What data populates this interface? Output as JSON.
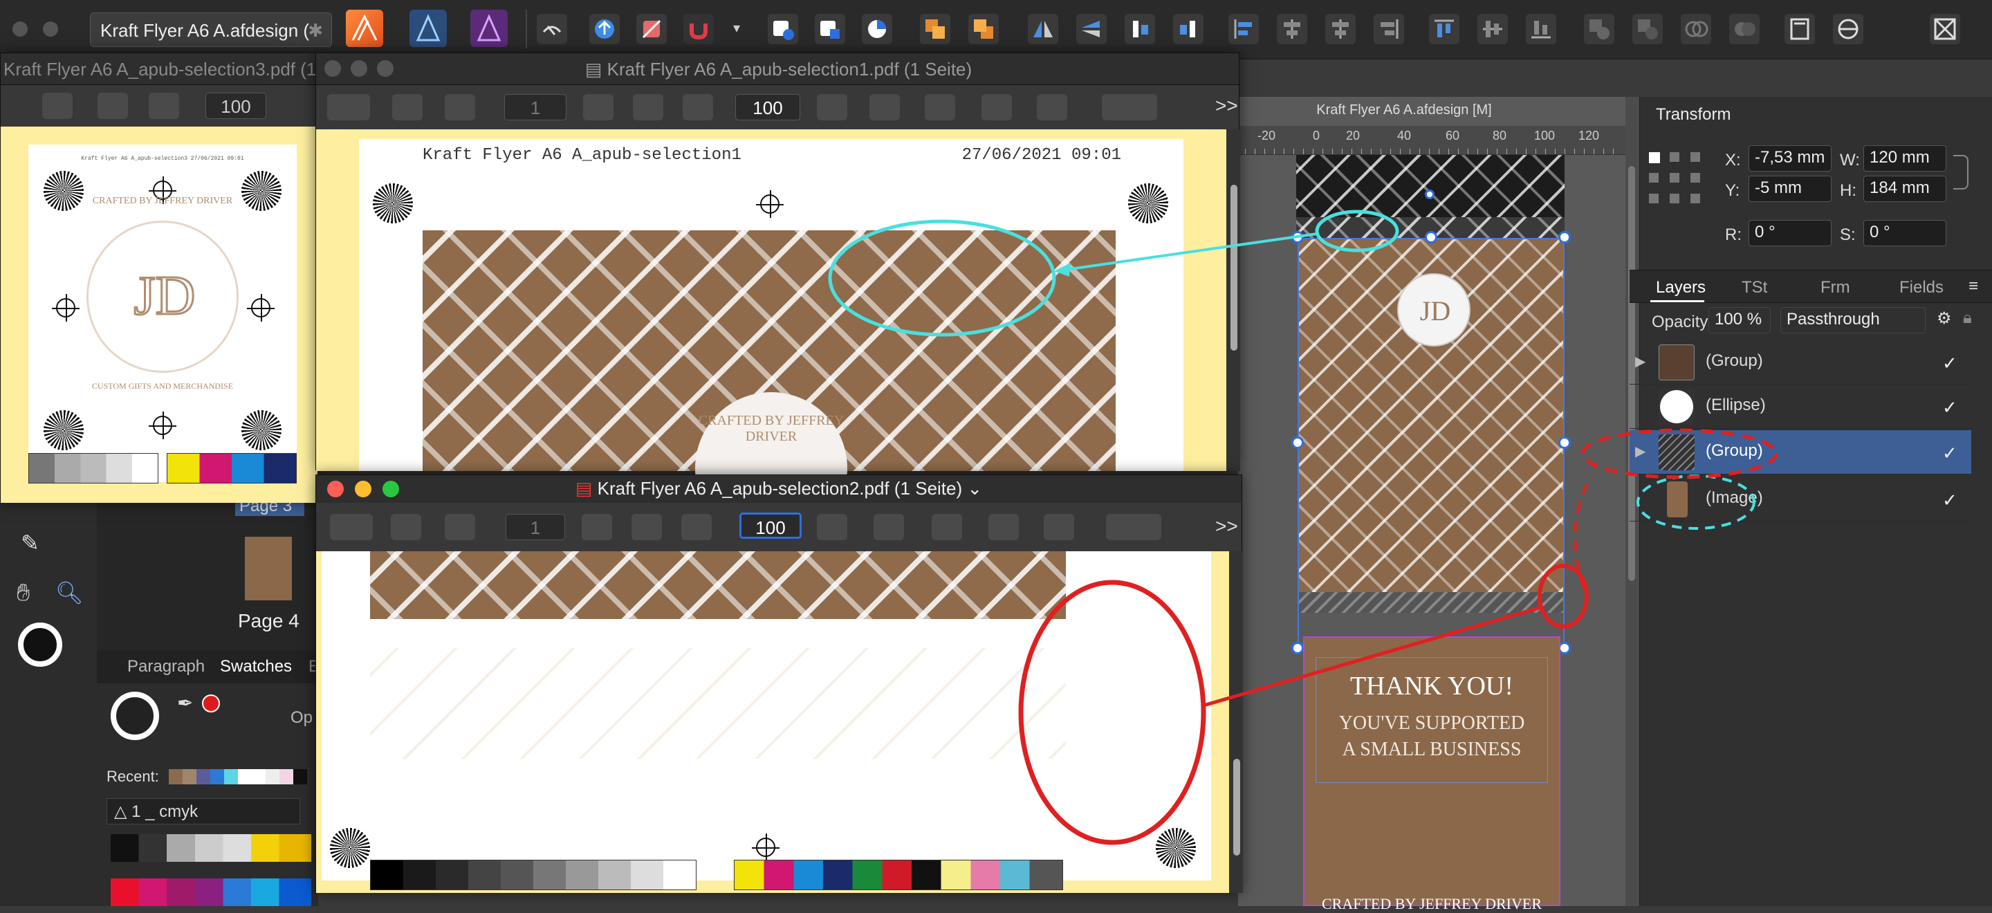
{
  "window": {
    "tab_title": "Kraft Flyer A6 A.afdesign (",
    "tab_close": "✱"
  },
  "canvas": {
    "doc_title": "Kraft Flyer A6 A.afdesign [M]",
    "ruler_ticks": [
      "-20",
      "0",
      "20",
      "40",
      "60",
      "80",
      "100",
      "120"
    ],
    "artboard_text": {
      "thank": "THANK YOU!",
      "supported": "YOU'VE SUPPORTED",
      "small": "A SMALL BUSINESS",
      "crafted": "CRAFTED BY JEFFREY DRIVER"
    }
  },
  "transform": {
    "title": "Transform",
    "x_label": "X:",
    "x_value": "-7,53 mm",
    "y_label": "Y:",
    "y_value": "-5 mm",
    "w_label": "W:",
    "w_value": "120 mm",
    "h_label": "H:",
    "h_value": "184 mm",
    "r_label": "R:",
    "r_value": "0 °",
    "s_label": "S:",
    "s_value": "0 °"
  },
  "layers": {
    "tabs": [
      "Layers",
      "TSt",
      "Frm",
      "Fields"
    ],
    "opacity_label": "Opacity:",
    "opacity_value": "100 %",
    "blend": "Passthrough",
    "items": [
      {
        "name": "(Group)",
        "checked": "✓"
      },
      {
        "name": "(Ellipse)",
        "checked": "✓"
      },
      {
        "name": "(Group)",
        "checked": "✓"
      },
      {
        "name": "(Image)",
        "checked": "✓"
      }
    ]
  },
  "left_panel": {
    "page_label": "Page 4",
    "page3_label": "Page 3",
    "tabs": [
      "Paragraph",
      "Swatches",
      "E"
    ],
    "recent_label": "Recent:",
    "palette": "1 _ cmyk",
    "op_label": "Op"
  },
  "pdf3": {
    "title": "Kraft Flyer A6 A_apub-selection3.pdf (1",
    "zoom": "100"
  },
  "pdf1": {
    "title": "Kraft Flyer A6 A_apub-selection1.pdf (1 Seite)",
    "page": "1",
    "zoom": "100",
    "header_left": "Kraft Flyer A6 A_apub-selection1",
    "header_right": "27/06/2021 09:01",
    "more": ">>"
  },
  "pdf2": {
    "title": "Kraft Flyer A6 A_apub-selection2.pdf (1 Seite)",
    "chev": "⌄",
    "page": "1",
    "zoom": "100",
    "more": ">>"
  },
  "logo": {
    "crafted": "CRAFTED BY JEFFREY DRIVER",
    "custom": "CUSTOM GIFTS AND MERCHANDISE"
  },
  "pdf3_header": "Kraft Flyer A6 A_apub-selection3  27/06/2021  09:01",
  "colors": {
    "annot_cyan": "#48e0e0",
    "annot_red": "#e02020",
    "selected_layer": "#3d5f96"
  }
}
